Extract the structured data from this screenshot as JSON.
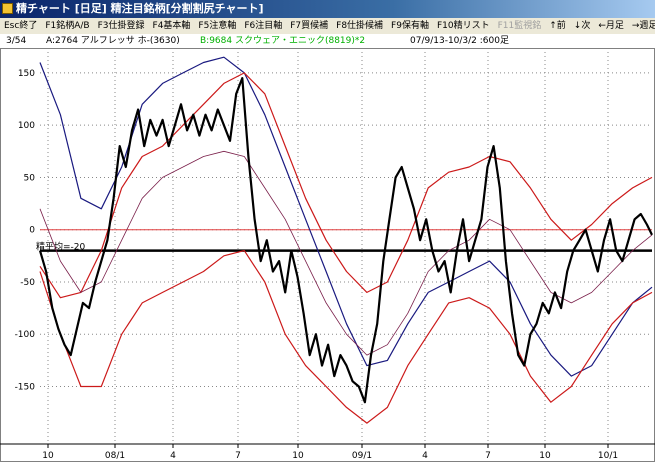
{
  "window": {
    "title": "精チャート [日足] 精注目銘柄[分割割尻チャート]"
  },
  "menu": [
    {
      "label": "Esc終了",
      "enabled": true
    },
    {
      "label": "F1銘柄A/B",
      "enabled": true
    },
    {
      "label": "F3仕掛登録",
      "enabled": true
    },
    {
      "label": "F4基本軸",
      "enabled": true
    },
    {
      "label": "F5注意軸",
      "enabled": true
    },
    {
      "label": "F6注目軸",
      "enabled": true
    },
    {
      "label": "F7買候補",
      "enabled": true
    },
    {
      "label": "F8仕掛候補",
      "enabled": true
    },
    {
      "label": "F9保有軸",
      "enabled": true
    },
    {
      "label": "F10精リスト",
      "enabled": true
    },
    {
      "label": "F11監視銘",
      "enabled": false
    },
    {
      "label": "↑前",
      "enabled": true
    },
    {
      "label": "↓次",
      "enabled": true
    },
    {
      "label": "←月足",
      "enabled": true
    },
    {
      "label": "→週足",
      "enabled": true
    }
  ],
  "info": {
    "counter": "3/54",
    "stock_a": "A:2764 アルフレッサ ホ-(3630)",
    "stock_b": "B:9684 スクウェア・エニック(8819)*2",
    "period": "07/9/13-10/3/2 :600足",
    "stock_b_color": "#00b000"
  },
  "chart_data": {
    "type": "line",
    "y_ticks": [
      150,
      100,
      50,
      0,
      -50,
      -100,
      -150
    ],
    "x_ticks": [
      "10",
      "08/1",
      "4",
      "7",
      "10",
      "09/1",
      "4",
      "7",
      "10",
      "10/1"
    ],
    "ylim": [
      -205,
      170
    ],
    "reference_lines": [
      {
        "y": 0,
        "color": "#e04040"
      },
      {
        "y": -20,
        "label": "精平均=-20",
        "color": "#000000"
      }
    ],
    "colors": {
      "main": "#000000",
      "mid": "#7a1f4a",
      "upper": "#cc1a1a",
      "lower": "#cc1a1a",
      "outer": "#1a1a80"
    },
    "series": [
      {
        "role": "main",
        "points": [
          [
            0,
            -20
          ],
          [
            6,
            -40
          ],
          [
            12,
            -75
          ],
          [
            18,
            -95
          ],
          [
            24,
            -110
          ],
          [
            30,
            -120
          ],
          [
            36,
            -95
          ],
          [
            42,
            -70
          ],
          [
            48,
            -75
          ],
          [
            54,
            -50
          ],
          [
            60,
            -30
          ],
          [
            66,
            -10
          ],
          [
            72,
            30
          ],
          [
            78,
            80
          ],
          [
            84,
            60
          ],
          [
            90,
            95
          ],
          [
            96,
            115
          ],
          [
            102,
            80
          ],
          [
            108,
            105
          ],
          [
            114,
            90
          ],
          [
            120,
            105
          ],
          [
            126,
            80
          ],
          [
            132,
            100
          ],
          [
            138,
            120
          ],
          [
            144,
            95
          ],
          [
            150,
            110
          ],
          [
            156,
            90
          ],
          [
            162,
            110
          ],
          [
            168,
            95
          ],
          [
            174,
            115
          ],
          [
            180,
            100
          ],
          [
            186,
            85
          ],
          [
            192,
            130
          ],
          [
            198,
            145
          ],
          [
            204,
            70
          ],
          [
            210,
            10
          ],
          [
            216,
            -30
          ],
          [
            222,
            -10
          ],
          [
            228,
            -40
          ],
          [
            234,
            -30
          ],
          [
            240,
            -60
          ],
          [
            246,
            -20
          ],
          [
            252,
            -45
          ],
          [
            258,
            -80
          ],
          [
            264,
            -120
          ],
          [
            270,
            -100
          ],
          [
            276,
            -130
          ],
          [
            282,
            -110
          ],
          [
            288,
            -140
          ],
          [
            294,
            -120
          ],
          [
            300,
            -130
          ],
          [
            306,
            -145
          ],
          [
            312,
            -150
          ],
          [
            318,
            -165
          ],
          [
            324,
            -120
          ],
          [
            330,
            -90
          ],
          [
            336,
            -30
          ],
          [
            342,
            10
          ],
          [
            348,
            50
          ],
          [
            354,
            60
          ],
          [
            360,
            40
          ],
          [
            366,
            20
          ],
          [
            372,
            -10
          ],
          [
            378,
            10
          ],
          [
            384,
            -20
          ],
          [
            390,
            -40
          ],
          [
            396,
            -30
          ],
          [
            402,
            -60
          ],
          [
            408,
            -20
          ],
          [
            414,
            10
          ],
          [
            420,
            -30
          ],
          [
            426,
            -10
          ],
          [
            432,
            10
          ],
          [
            438,
            60
          ],
          [
            444,
            80
          ],
          [
            450,
            40
          ],
          [
            456,
            -30
          ],
          [
            462,
            -80
          ],
          [
            468,
            -120
          ],
          [
            474,
            -130
          ],
          [
            480,
            -100
          ],
          [
            486,
            -90
          ],
          [
            492,
            -70
          ],
          [
            498,
            -80
          ],
          [
            504,
            -60
          ],
          [
            510,
            -75
          ],
          [
            516,
            -40
          ],
          [
            522,
            -20
          ],
          [
            528,
            -10
          ],
          [
            534,
            0
          ],
          [
            540,
            -20
          ],
          [
            546,
            -40
          ],
          [
            552,
            -10
          ],
          [
            558,
            10
          ],
          [
            564,
            -20
          ],
          [
            570,
            -30
          ],
          [
            576,
            -10
          ],
          [
            582,
            10
          ],
          [
            588,
            15
          ],
          [
            594,
            5
          ],
          [
            599,
            -5
          ]
        ]
      },
      {
        "role": "mid",
        "points": [
          [
            0,
            20
          ],
          [
            20,
            -30
          ],
          [
            40,
            -60
          ],
          [
            60,
            -50
          ],
          [
            80,
            -10
          ],
          [
            100,
            30
          ],
          [
            120,
            50
          ],
          [
            140,
            60
          ],
          [
            160,
            70
          ],
          [
            180,
            75
          ],
          [
            200,
            70
          ],
          [
            220,
            40
          ],
          [
            240,
            10
          ],
          [
            260,
            -30
          ],
          [
            280,
            -70
          ],
          [
            300,
            -100
          ],
          [
            320,
            -120
          ],
          [
            340,
            -110
          ],
          [
            360,
            -80
          ],
          [
            380,
            -40
          ],
          [
            400,
            -20
          ],
          [
            420,
            -10
          ],
          [
            440,
            10
          ],
          [
            460,
            0
          ],
          [
            480,
            -30
          ],
          [
            500,
            -60
          ],
          [
            520,
            -70
          ],
          [
            540,
            -60
          ],
          [
            560,
            -40
          ],
          [
            580,
            -20
          ],
          [
            599,
            -5
          ]
        ]
      },
      {
        "role": "upper",
        "points": [
          [
            0,
            -35
          ],
          [
            20,
            -65
          ],
          [
            40,
            -60
          ],
          [
            60,
            -20
          ],
          [
            80,
            40
          ],
          [
            100,
            70
          ],
          [
            120,
            80
          ],
          [
            140,
            100
          ],
          [
            160,
            120
          ],
          [
            180,
            140
          ],
          [
            200,
            150
          ],
          [
            220,
            130
          ],
          [
            240,
            80
          ],
          [
            260,
            30
          ],
          [
            280,
            -10
          ],
          [
            300,
            -40
          ],
          [
            320,
            -60
          ],
          [
            340,
            -50
          ],
          [
            360,
            -10
          ],
          [
            380,
            40
          ],
          [
            400,
            55
          ],
          [
            420,
            60
          ],
          [
            440,
            70
          ],
          [
            460,
            65
          ],
          [
            480,
            40
          ],
          [
            500,
            10
          ],
          [
            520,
            -10
          ],
          [
            540,
            5
          ],
          [
            560,
            25
          ],
          [
            580,
            40
          ],
          [
            599,
            50
          ]
        ]
      },
      {
        "role": "lower",
        "points": [
          [
            0,
            -40
          ],
          [
            20,
            -100
          ],
          [
            40,
            -150
          ],
          [
            60,
            -150
          ],
          [
            80,
            -100
          ],
          [
            100,
            -70
          ],
          [
            120,
            -60
          ],
          [
            140,
            -50
          ],
          [
            160,
            -40
          ],
          [
            180,
            -25
          ],
          [
            200,
            -20
          ],
          [
            220,
            -50
          ],
          [
            240,
            -100
          ],
          [
            260,
            -130
          ],
          [
            280,
            -150
          ],
          [
            300,
            -170
          ],
          [
            320,
            -185
          ],
          [
            340,
            -170
          ],
          [
            360,
            -130
          ],
          [
            380,
            -100
          ],
          [
            400,
            -70
          ],
          [
            420,
            -65
          ],
          [
            440,
            -75
          ],
          [
            460,
            -100
          ],
          [
            480,
            -140
          ],
          [
            500,
            -165
          ],
          [
            520,
            -150
          ],
          [
            540,
            -120
          ],
          [
            560,
            -90
          ],
          [
            580,
            -70
          ],
          [
            599,
            -60
          ]
        ]
      },
      {
        "role": "outer",
        "points": [
          [
            0,
            160
          ],
          [
            20,
            110
          ],
          [
            40,
            30
          ],
          [
            60,
            20
          ],
          [
            80,
            60
          ],
          [
            100,
            120
          ],
          [
            120,
            140
          ],
          [
            140,
            150
          ],
          [
            160,
            160
          ],
          [
            180,
            165
          ],
          [
            200,
            150
          ],
          [
            220,
            110
          ],
          [
            240,
            60
          ],
          [
            260,
            10
          ],
          [
            280,
            -40
          ],
          [
            300,
            -90
          ],
          [
            320,
            -130
          ],
          [
            340,
            -125
          ],
          [
            360,
            -90
          ],
          [
            380,
            -60
          ],
          [
            400,
            -50
          ],
          [
            420,
            -40
          ],
          [
            440,
            -30
          ],
          [
            460,
            -50
          ],
          [
            480,
            -90
          ],
          [
            500,
            -120
          ],
          [
            520,
            -140
          ],
          [
            540,
            -130
          ],
          [
            560,
            -100
          ],
          [
            580,
            -70
          ],
          [
            599,
            -55
          ]
        ]
      }
    ]
  }
}
